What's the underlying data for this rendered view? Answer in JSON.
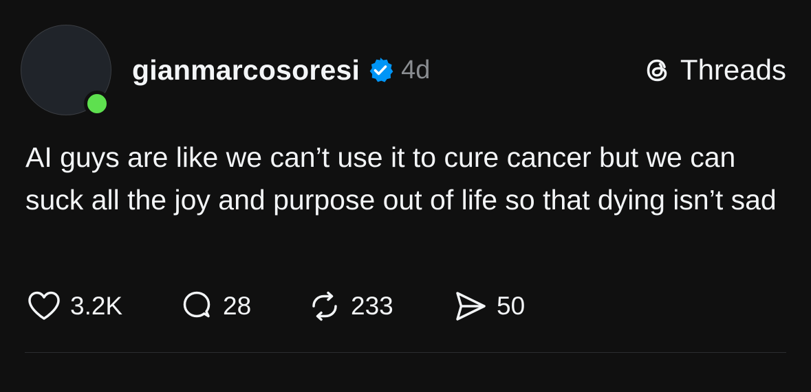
{
  "post": {
    "username": "gianmarcosoresi",
    "verified_icon": "verified-badge-icon",
    "time_ago": "4d",
    "text": "AI guys are like we can’t use it to cure cancer but we can suck all the joy and purpose out of life so that dying isn’t sad",
    "online_status_color": "#5ee04f",
    "verified_color": "#0095f6"
  },
  "brand": {
    "icon": "threads-logo-icon",
    "label": "Threads"
  },
  "actions": {
    "like": {
      "icon": "heart-icon",
      "count": "3.2K"
    },
    "reply": {
      "icon": "comment-icon",
      "count": "28"
    },
    "repost": {
      "icon": "repost-icon",
      "count": "233"
    },
    "share": {
      "icon": "send-icon",
      "count": "50"
    }
  }
}
